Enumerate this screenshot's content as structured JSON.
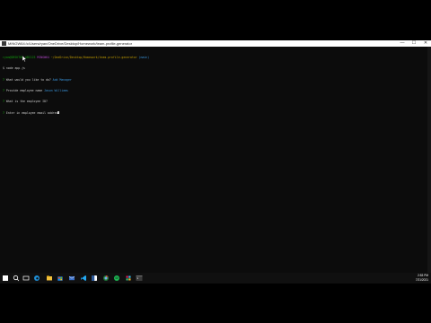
{
  "window": {
    "title": "MINGW64:/c/Users/ryan/OneDrive/Desktop/Homework/team-profile-generator",
    "controls": [
      "—",
      "☐",
      "✕"
    ]
  },
  "terminal": {
    "prompt": {
      "user": "ryan@DESKTOP-ABC123",
      "env": "MINGW64",
      "path": "~/OneDrive/Desktop/Homework/team-profile-generator",
      "branch": "(main)"
    },
    "lines": [
      {
        "prefix": "$ ",
        "text": "node app.js"
      },
      {
        "prefix": "? ",
        "text": "What would you like to do? ",
        "answer": "Add Manager"
      },
      {
        "prefix": "? ",
        "text": "Provide employee name ",
        "answer": "Jason Williams"
      },
      {
        "prefix": "? ",
        "text": "What is the employee ID? ",
        "answer": ""
      },
      {
        "prefix": "? ",
        "text": "Enter in employee email addres",
        "answer": ""
      }
    ]
  },
  "taskbar": {
    "icons": [
      "search-icon",
      "task-view-icon",
      "edge-icon",
      "file-explorer-icon",
      "store-icon",
      "mail-icon",
      "vscode-icon",
      "word-icon",
      "chrome-icon",
      "spotify-icon",
      "slack-icon",
      "terminal-icon"
    ],
    "time": "2:53 PM",
    "date": "7/21/2021"
  }
}
